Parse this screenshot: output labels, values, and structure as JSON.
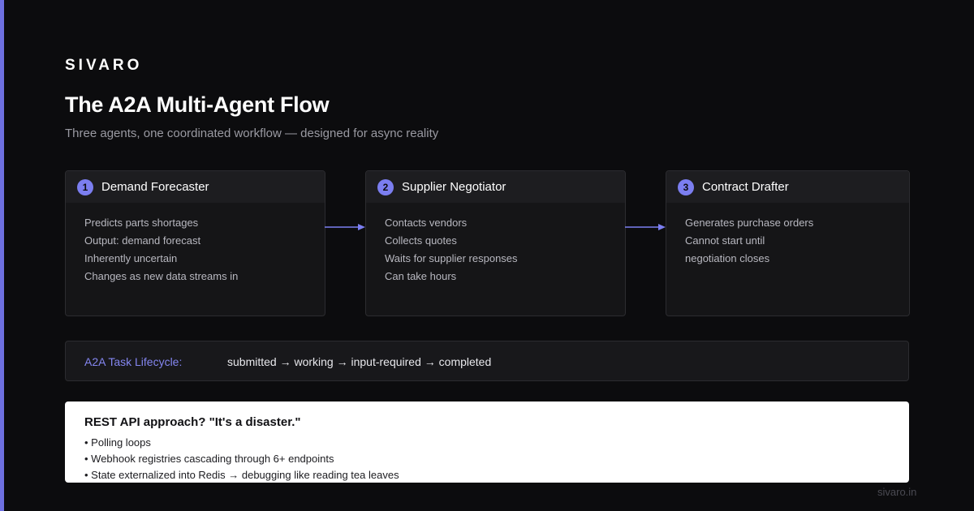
{
  "brand": "SIVARO",
  "title": "The A2A Multi-Agent Flow",
  "subtitle": "Three agents, one coordinated workflow — designed for async reality",
  "agents": [
    {
      "number": "1",
      "name": "Demand Forecaster",
      "lines": [
        "Predicts parts shortages",
        "Output: demand forecast",
        "Inherently uncertain",
        "Changes as new data streams in"
      ]
    },
    {
      "number": "2",
      "name": "Supplier Negotiator",
      "lines": [
        "Contacts vendors",
        "Collects quotes",
        "Waits for supplier responses",
        "Can take hours"
      ]
    },
    {
      "number": "3",
      "name": "Contract Drafter",
      "lines": [
        "Generates purchase orders",
        "Cannot start until",
        "negotiation closes"
      ]
    }
  ],
  "lifecycle": {
    "label": "A2A Task Lifecycle:",
    "steps": "submitted → working → input-required → completed"
  },
  "rest_panel": {
    "title": "REST API approach? \"It's a disaster.\"",
    "points": [
      "• Polling loops",
      "• Webhook registries cascading through 6+ endpoints",
      "• State externalized into Redis → debugging like reading tea leaves"
    ]
  },
  "footer_url": "sivaro.in",
  "colors": {
    "accent": "#7b7ef0",
    "background": "#0c0c0e",
    "card": "#151517",
    "panel": "#ffffff"
  }
}
